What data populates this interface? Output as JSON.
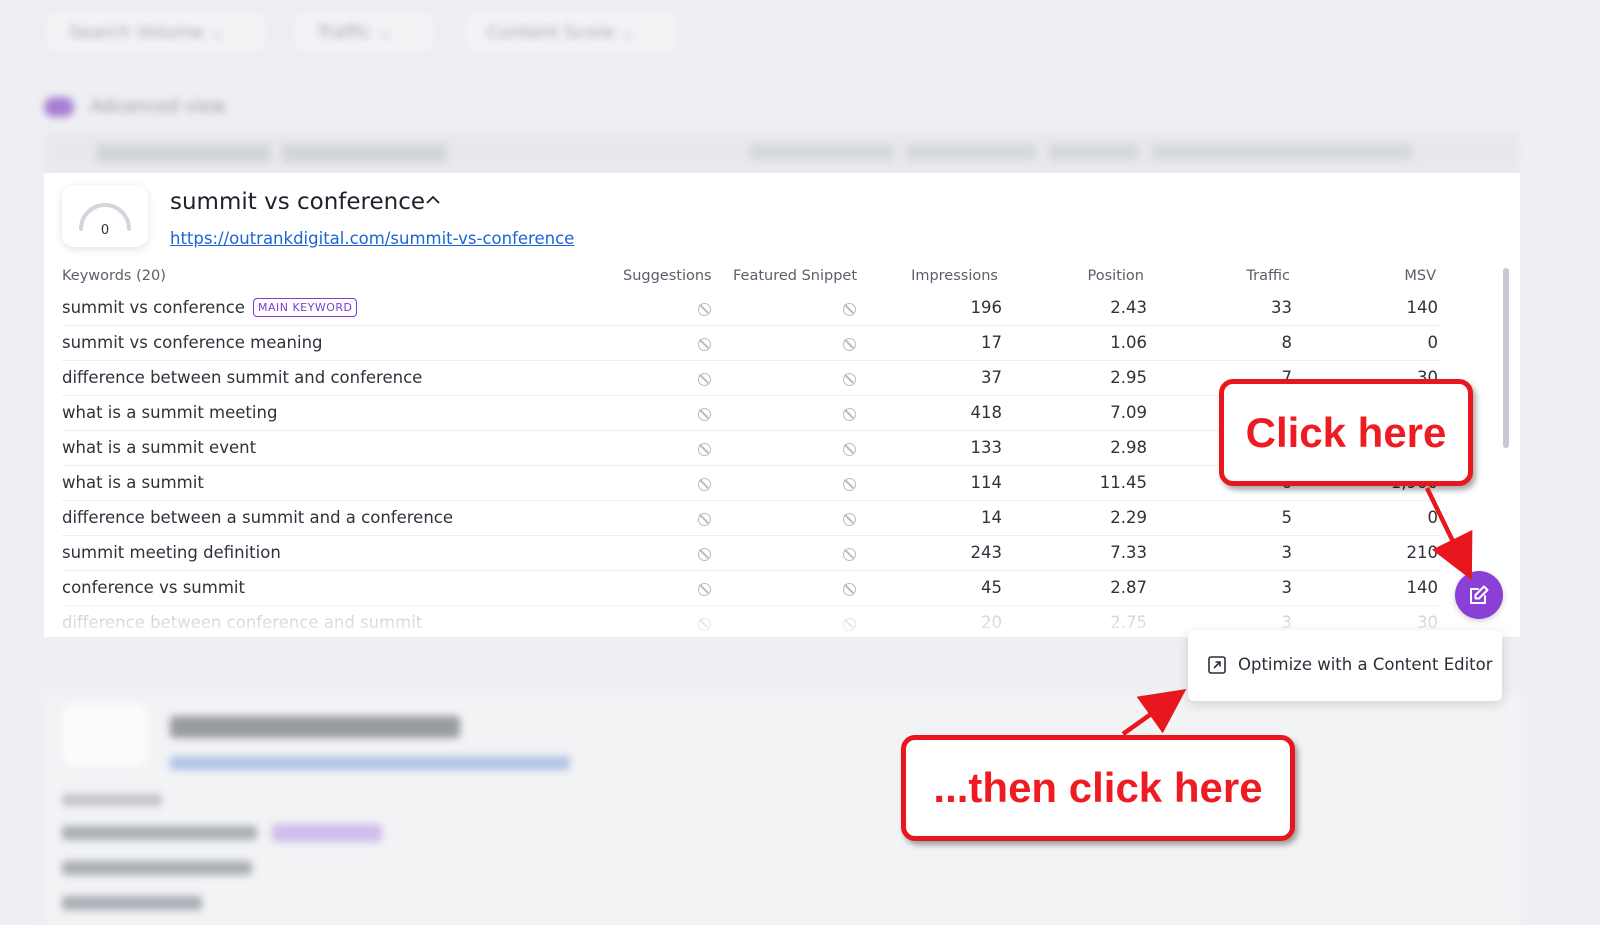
{
  "filters": [
    "Search Volume",
    "Traffic",
    "Content Score"
  ],
  "advanced_view_label": "Advanced view",
  "card": {
    "score": "0",
    "title": "summit vs conference",
    "url": "https://outrankdigital.com/summit-vs-conference",
    "headers": {
      "keywords": "Keywords (20)",
      "suggestions": "Suggestions",
      "featured_snippet": "Featured Snippet",
      "impressions": "Impressions",
      "position": "Position",
      "traffic": "Traffic",
      "msv": "MSV"
    },
    "main_keyword_badge": "MAIN KEYWORD",
    "rows": [
      {
        "keyword": "summit vs conference",
        "impressions": "196",
        "position": "2.43",
        "traffic": "33",
        "msv": "140"
      },
      {
        "keyword": "summit vs conference meaning",
        "impressions": "17",
        "position": "1.06",
        "traffic": "8",
        "msv": "0"
      },
      {
        "keyword": "difference between summit and conference",
        "impressions": "37",
        "position": "2.95",
        "traffic": "7",
        "msv": "30"
      },
      {
        "keyword": "what is a summit meeting",
        "impressions": "418",
        "position": "7.09",
        "traffic": "",
        "msv": ""
      },
      {
        "keyword": "what is a summit event",
        "impressions": "133",
        "position": "2.98",
        "traffic": "",
        "msv": ""
      },
      {
        "keyword": "what is a summit",
        "impressions": "114",
        "position": "11.45",
        "traffic": "6",
        "msv": "1,900"
      },
      {
        "keyword": "difference between a summit and a conference",
        "impressions": "14",
        "position": "2.29",
        "traffic": "5",
        "msv": "0"
      },
      {
        "keyword": "summit meeting definition",
        "impressions": "243",
        "position": "7.33",
        "traffic": "3",
        "msv": "210"
      },
      {
        "keyword": "conference vs summit",
        "impressions": "45",
        "position": "2.87",
        "traffic": "3",
        "msv": "140"
      },
      {
        "keyword": "difference between conference and summit",
        "impressions": "20",
        "position": "2.75",
        "traffic": "3",
        "msv": "30"
      }
    ]
  },
  "menu": {
    "optimize_label": "Optimize with a Content Editor"
  },
  "callouts": {
    "first": "Click here",
    "second": "...then click here"
  },
  "colors": {
    "accent": "#8a3fd6",
    "callout_red": "#ee1c22",
    "link": "#1c64d8"
  }
}
